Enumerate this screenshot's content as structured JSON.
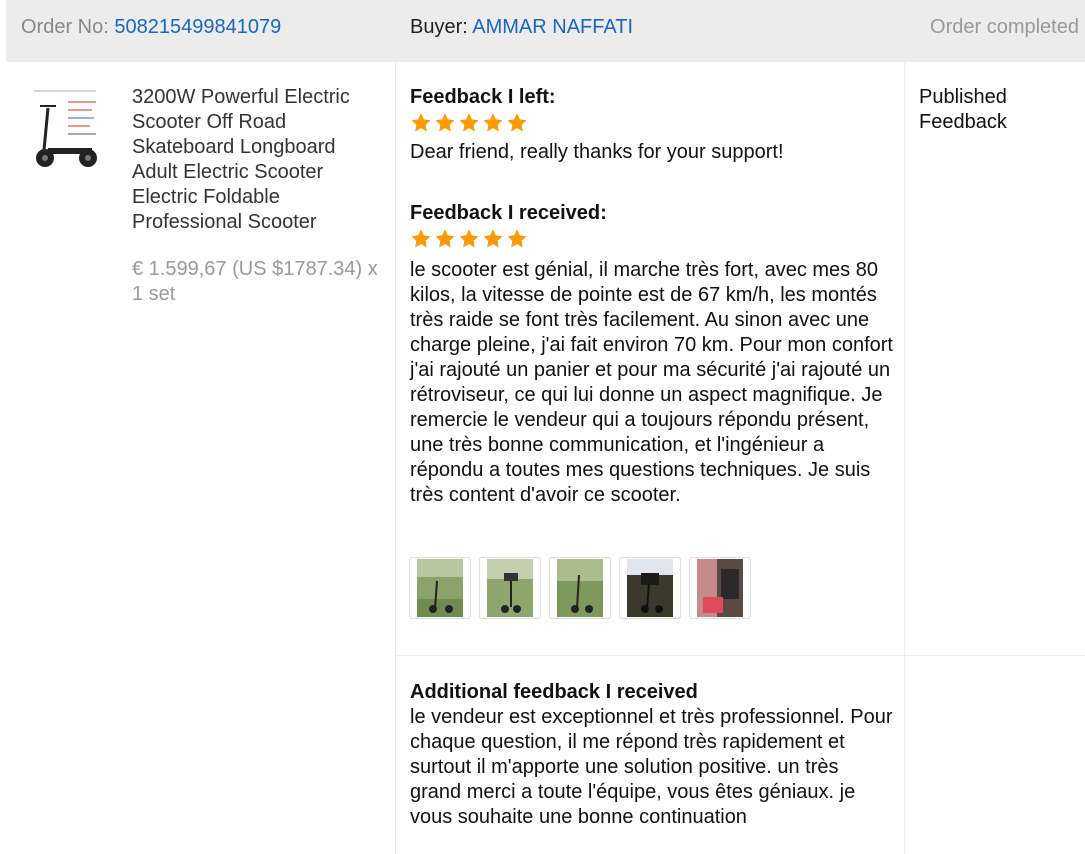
{
  "header": {
    "order_label": "Order No:",
    "order_number": "508215499841079",
    "buyer_label": "Buyer:",
    "buyer_name": "AMMAR NAFFATI",
    "status": "Order completed"
  },
  "product": {
    "title": "3200W Powerful Electric Scooter Off Road Skateboard Longboard Adult Electric Scooter Electric Foldable Professional Scooter",
    "price": "€ 1.599,67 (US $1787.34) x 1 set",
    "image_icon": "scooter-image"
  },
  "feedback_left": {
    "heading": "Feedback I left:",
    "rating": 5,
    "text": "Dear friend, really thanks for your support!"
  },
  "feedback_received": {
    "heading": "Feedback I received:",
    "rating": 5,
    "text": "le scooter est génial, il marche très fort, avec mes 80 kilos, la vitesse de pointe est de 67 km/h, les montés très raide se font très facilement. Au sinon avec une charge pleine, j'ai fait environ 70 km. Pour mon confort j'ai rajouté un panier et pour ma sécurité j'ai rajouté un rétroviseur, ce qui lui donne un aspect magnifique. Je remercie le vendeur qui a toujours répondu présent, une très bonne communication, et l'ingénieur a répondu a toutes mes questions techniques. Je suis très content d'avoir ce scooter.",
    "photo_count": 5
  },
  "status_column": {
    "label": "Published Feedback"
  },
  "additional": {
    "heading": "Additional feedback I received",
    "text": "le vendeur est exceptionnel et très professionnel. Pour chaque question, il me répond très rapidement et surtout il m'apporte une solution positive. un très grand merci a toute l'équipe, vous êtes géniaux. je vous souhaite une bonne continuation"
  },
  "colors": {
    "link": "#1a66b8",
    "star": "#ff9900",
    "header_bg": "#ececec"
  }
}
